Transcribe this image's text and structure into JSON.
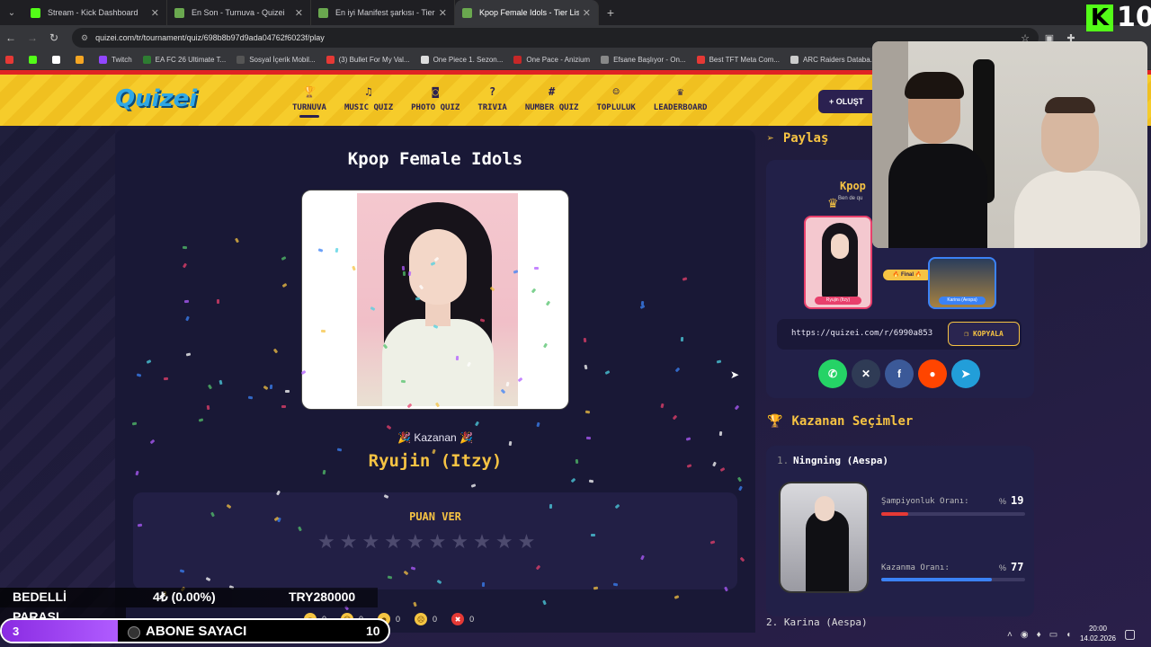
{
  "browser": {
    "tabs": [
      {
        "title": "Stream - Kick Dashboard",
        "color": "#53fc18",
        "active": false
      },
      {
        "title": "En Son - Turnuva - Quizei",
        "color": "#6aa84f",
        "active": false
      },
      {
        "title": "En iyi Manifest şarkısı - Tier List",
        "color": "#6aa84f",
        "active": false
      },
      {
        "title": "Kpop Female Idols - Tier List, K",
        "color": "#6aa84f",
        "active": true
      }
    ],
    "url": "quizei.com/tr/tournament/quiz/698b8b97d9ada04762f6023f/play",
    "bookmarks": [
      {
        "label": "",
        "color": "#e53935"
      },
      {
        "label": "",
        "color": "#53fc18"
      },
      {
        "label": "",
        "color": "#ffffff"
      },
      {
        "label": "",
        "color": "#f5a623"
      },
      {
        "label": "Twitch",
        "color": "#9146ff"
      },
      {
        "label": "EA FC 26 Ultimate T...",
        "color": "#2e7d32"
      },
      {
        "label": "Sosyal İçerik Mobil...",
        "color": "#555555"
      },
      {
        "label": "(3) Bullet For My Val...",
        "color": "#e53935"
      },
      {
        "label": "One Piece 1. Sezon...",
        "color": "#dddddd"
      },
      {
        "label": "One Pace - Anizium",
        "color": "#c62828"
      },
      {
        "label": "Efsane Başlıyor - On...",
        "color": "#888888"
      },
      {
        "label": "Best TFT Meta Com...",
        "color": "#e53935"
      },
      {
        "label": "ARC Raiders Databa...",
        "color": "#cccccc"
      }
    ]
  },
  "site": {
    "logo": "Quizei",
    "nav": [
      {
        "label": "TURNUVA",
        "icon": "trophy-icon",
        "glyph": "🏆",
        "active": true
      },
      {
        "label": "MUSIC QUIZ",
        "icon": "music-note-icon",
        "glyph": "♫",
        "active": false
      },
      {
        "label": "PHOTO QUIZ",
        "icon": "camera-icon",
        "glyph": "◙",
        "active": false
      },
      {
        "label": "TRIVIA",
        "icon": "question-bubble-icon",
        "glyph": "?",
        "active": false
      },
      {
        "label": "NUMBER QUIZ",
        "icon": "hash-icon",
        "glyph": "#",
        "active": false
      },
      {
        "label": "TOPLULUK",
        "icon": "users-icon",
        "glyph": "☺",
        "active": false
      },
      {
        "label": "LEADERBOARD",
        "icon": "medal-icon",
        "glyph": "♛",
        "active": false
      }
    ],
    "create_label": "+ OLUŞT"
  },
  "quiz": {
    "title": "Kpop Female Idols",
    "winner_label": "Kazanan",
    "winner_name": "Ryujin (Itzy)",
    "rate_title": "PUAN VER",
    "star_count": 10,
    "reactions": [
      {
        "emoji": "☺",
        "count": "0",
        "red": false
      },
      {
        "emoji": "☹",
        "count": "0",
        "red": false
      },
      {
        "emoji": "☻",
        "count": "0",
        "red": false
      },
      {
        "emoji": "☹",
        "count": "0",
        "red": false
      },
      {
        "emoji": "✖",
        "count": "0",
        "red": true
      }
    ]
  },
  "share": {
    "heading": "Paylaş",
    "preview_title": "Kpop",
    "preview_sub": "Ben de qu",
    "preview_winner": "Ryujin (Itzy)",
    "preview_runnerup": "Karina (Aespa)",
    "final_label": "🔥 Final 🔥",
    "link": "https://quizei.com/r/6990a853",
    "copy_label": "KOPYALA",
    "socials": [
      {
        "name": "whatsapp-icon",
        "glyph": "✆",
        "color": "#25d366"
      },
      {
        "name": "x-icon",
        "glyph": "✕",
        "color": "#2f3b55"
      },
      {
        "name": "facebook-icon",
        "glyph": "f",
        "color": "#3b5998"
      },
      {
        "name": "reddit-icon",
        "glyph": "●",
        "color": "#ff4500"
      },
      {
        "name": "telegram-icon",
        "glyph": "➤",
        "color": "#229ed9"
      }
    ]
  },
  "winners": {
    "heading": "Kazanan Seçimler",
    "items": [
      {
        "rank": "1.",
        "name": "Ningning (Aespa)",
        "champ_label": "Şampiyonluk Oranı:",
        "champ_value": "19",
        "champ_fraction": 0.19,
        "win_label": "Kazanma Oranı:",
        "win_value": "77",
        "win_fraction": 0.77,
        "pct_symbol": "%"
      }
    ],
    "next_name": "Karina (Aespa)"
  },
  "overlay": {
    "donation_label": "BEDELLİ",
    "donation_label2": "PARASI",
    "donation_amount": "4₺ (0.00%)",
    "donation_goal": "TRY280000",
    "sub_current": "3",
    "sub_label": "ABONE SAYACI",
    "sub_target": "10",
    "sub_fraction": 0.3,
    "kick_count": "10"
  },
  "system": {
    "time": "20:00",
    "date": "14.02.2026"
  }
}
